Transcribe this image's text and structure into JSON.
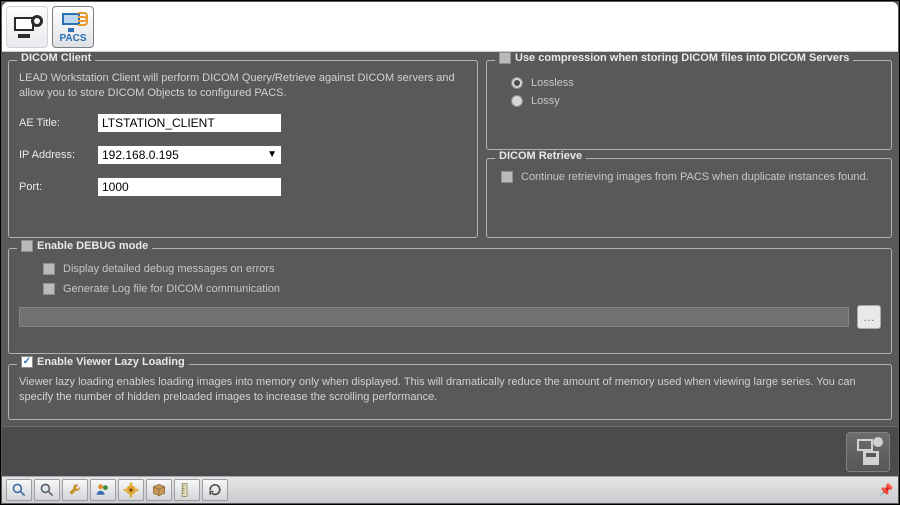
{
  "tabs": {
    "workstation_label": "",
    "pacs_label": "PACS"
  },
  "dicom_client": {
    "legend": "DICOM Client",
    "description": "LEAD Workstation Client will perform DICOM Query/Retrieve against DICOM servers and allow you to store DICOM Objects to configured PACS.",
    "ae_title_label": "AE Title:",
    "ae_title_value": "LTSTATION_CLIENT",
    "ip_label": "IP Address:",
    "ip_value": "192.168.0.195",
    "port_label": "Port:",
    "port_value": "1000"
  },
  "compression": {
    "legend": "Use compression when storing DICOM files into DICOM Servers",
    "lossless": "Lossless",
    "lossy": "Lossy",
    "selected": "lossless"
  },
  "retrieve": {
    "legend": "DICOM Retrieve",
    "continue_label": "Continue retrieving images from PACS when duplicate instances found."
  },
  "debug": {
    "legend": "Enable DEBUG mode",
    "display_label": "Display detailed debug messages on errors",
    "generate_label": "Generate Log file for DICOM communication",
    "log_path": "",
    "browse_label": "…"
  },
  "lazy": {
    "legend": "Enable Viewer Lazy Loading",
    "checked": true,
    "description": "Viewer lazy loading enables loading images into memory only when displayed. This will dramatically reduce the amount of memory used when viewing large series. You can specify the number of hidden preloaded images to increase the scrolling performance."
  },
  "apply_tooltip": "Apply",
  "bottom_icons": [
    "search",
    "magnify",
    "wrench",
    "users",
    "gear",
    "disk",
    "ruler",
    "refresh"
  ]
}
